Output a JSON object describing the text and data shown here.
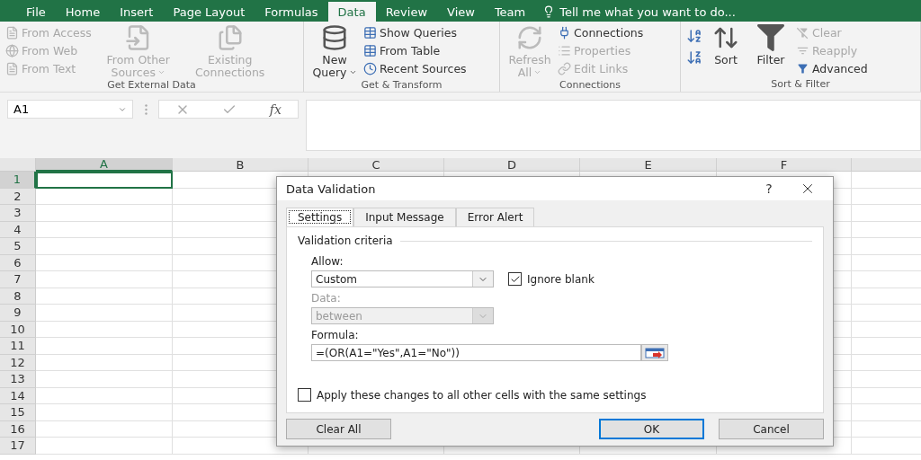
{
  "menu_tabs": [
    {
      "label": "File",
      "selected": false
    },
    {
      "label": "Home",
      "selected": false
    },
    {
      "label": "Insert",
      "selected": false
    },
    {
      "label": "Page Layout",
      "selected": false
    },
    {
      "label": "Formulas",
      "selected": false
    },
    {
      "label": "Data",
      "selected": true
    },
    {
      "label": "Review",
      "selected": false
    },
    {
      "label": "View",
      "selected": false
    },
    {
      "label": "Team",
      "selected": false
    }
  ],
  "tell_me": "Tell me what you want to do...",
  "ribbon_groups": [
    {
      "label": "Get External Data",
      "columns": [
        {
          "kind": "stack",
          "items": [
            {
              "label": "From Access",
              "disabled": true
            },
            {
              "label": "From Web",
              "disabled": true
            },
            {
              "label": "From Text",
              "disabled": true
            }
          ]
        },
        {
          "kind": "large",
          "label": "From Other Sources",
          "disabled": true,
          "dropdown": true
        },
        {
          "kind": "large",
          "label": "Existing Connections",
          "disabled": true,
          "dropdown": false
        }
      ]
    },
    {
      "label": "Get & Transform",
      "columns": [
        {
          "kind": "large",
          "label": "New Query",
          "disabled": false,
          "dropdown": true
        },
        {
          "kind": "stack",
          "items": [
            {
              "label": "Show Queries",
              "disabled": false
            },
            {
              "label": "From Table",
              "disabled": false
            },
            {
              "label": "Recent Sources",
              "disabled": false
            }
          ]
        }
      ]
    },
    {
      "label": "Connections",
      "columns": [
        {
          "kind": "large",
          "label": "Refresh All",
          "disabled": true,
          "dropdown": true
        },
        {
          "kind": "stack",
          "items": [
            {
              "label": "Connections",
              "disabled": false
            },
            {
              "label": "Properties",
              "disabled": true
            },
            {
              "label": "Edit Links",
              "disabled": true
            }
          ]
        }
      ]
    },
    {
      "label": "Sort & Filter",
      "columns": [
        {
          "kind": "icons"
        },
        {
          "kind": "large",
          "label": "Sort",
          "disabled": false,
          "dropdown": false
        },
        {
          "kind": "large",
          "label": "Filter",
          "disabled": false,
          "dropdown": false
        },
        {
          "kind": "stack",
          "items": [
            {
              "label": "Clear",
              "disabled": true
            },
            {
              "label": "Reapply",
              "disabled": true
            },
            {
              "label": "Advanced",
              "disabled": false
            }
          ]
        }
      ]
    }
  ],
  "formula_bar": {
    "name_box": "A1",
    "fx": "fx"
  },
  "sheet": {
    "columns": [
      {
        "label": "A",
        "selected": true
      },
      {
        "label": "B",
        "selected": false
      },
      {
        "label": "C",
        "selected": false
      },
      {
        "label": "D",
        "selected": false
      },
      {
        "label": "E",
        "selected": false
      },
      {
        "label": "F",
        "selected": false
      }
    ],
    "rows": [
      {
        "label": "1",
        "selected": true
      },
      {
        "label": "2",
        "selected": false
      },
      {
        "label": "3",
        "selected": false
      },
      {
        "label": "4",
        "selected": false
      },
      {
        "label": "5",
        "selected": false
      },
      {
        "label": "6",
        "selected": false
      },
      {
        "label": "7",
        "selected": false
      },
      {
        "label": "8",
        "selected": false
      },
      {
        "label": "9",
        "selected": false
      },
      {
        "label": "10",
        "selected": false
      },
      {
        "label": "11",
        "selected": false
      },
      {
        "label": "12",
        "selected": false
      },
      {
        "label": "13",
        "selected": false
      },
      {
        "label": "14",
        "selected": false
      },
      {
        "label": "15",
        "selected": false
      },
      {
        "label": "16",
        "selected": false
      },
      {
        "label": "17",
        "selected": false
      }
    ]
  },
  "dialog": {
    "title": "Data Validation",
    "help": "?",
    "tabs": [
      {
        "label": "Settings",
        "selected": true
      },
      {
        "label": "Input Message",
        "selected": false
      },
      {
        "label": "Error Alert",
        "selected": false
      }
    ],
    "section": "Validation criteria",
    "allow": {
      "label": "Allow:",
      "value": "Custom"
    },
    "ignore_blank": {
      "label": "Ignore blank",
      "checked": true
    },
    "data": {
      "label": "Data:",
      "value": "between",
      "disabled": true
    },
    "formula": {
      "label": "Formula:",
      "value": "=(OR(A1=\"Yes\",A1=\"No\"))"
    },
    "apply_all": {
      "label": "Apply these changes to all other cells with the same settings",
      "checked": false
    },
    "buttons": [
      {
        "label": "Clear All",
        "default": false
      },
      {
        "label": "OK",
        "default": true
      },
      {
        "label": "Cancel",
        "default": false
      }
    ]
  }
}
